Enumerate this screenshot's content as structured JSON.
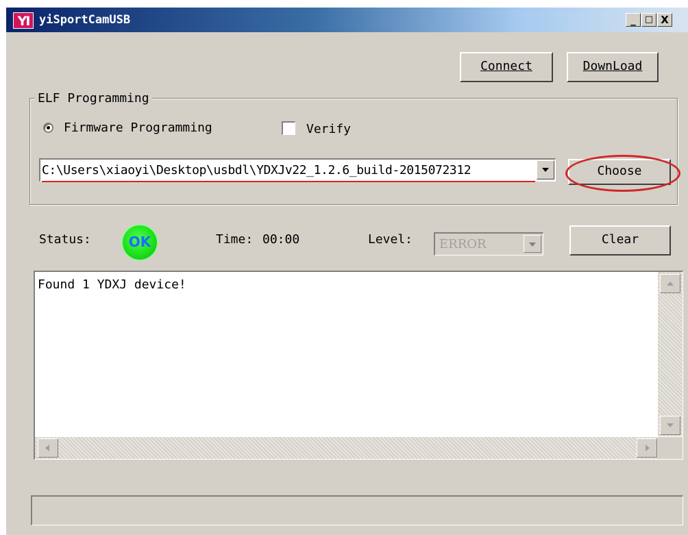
{
  "window": {
    "title": "yiSportCamUSB",
    "logo_text": "YI",
    "controls": {
      "minimize": "_",
      "maximize": "□",
      "close": "X"
    }
  },
  "toolbar": {
    "connect_label": "Connect",
    "download_label": "DownLoad"
  },
  "elf_group": {
    "legend": "ELF Programming",
    "firmware_label": "Firmware Programming",
    "firmware_checked": true,
    "verify_label": "Verify",
    "verify_checked": false,
    "path_value": "C:\\Users\\xiaoyi\\Desktop\\usbdl\\YDXJv22_1.2.6_build-2015072312",
    "choose_label": "Choose"
  },
  "status_bar": {
    "status_label": "Status:",
    "status_value": "OK",
    "status_color": "#22e022",
    "time_label": "Time:",
    "time_value": "00:00",
    "level_label": "Level:",
    "level_value": "ERROR",
    "clear_label": "Clear"
  },
  "log": {
    "text": "Found 1 YDXJ device!"
  },
  "progress": {
    "fraction": 0
  },
  "colors": {
    "face": "#d4d0c8",
    "highlight_circle": "#d02828",
    "title_gradient_start": "#0a246a"
  }
}
